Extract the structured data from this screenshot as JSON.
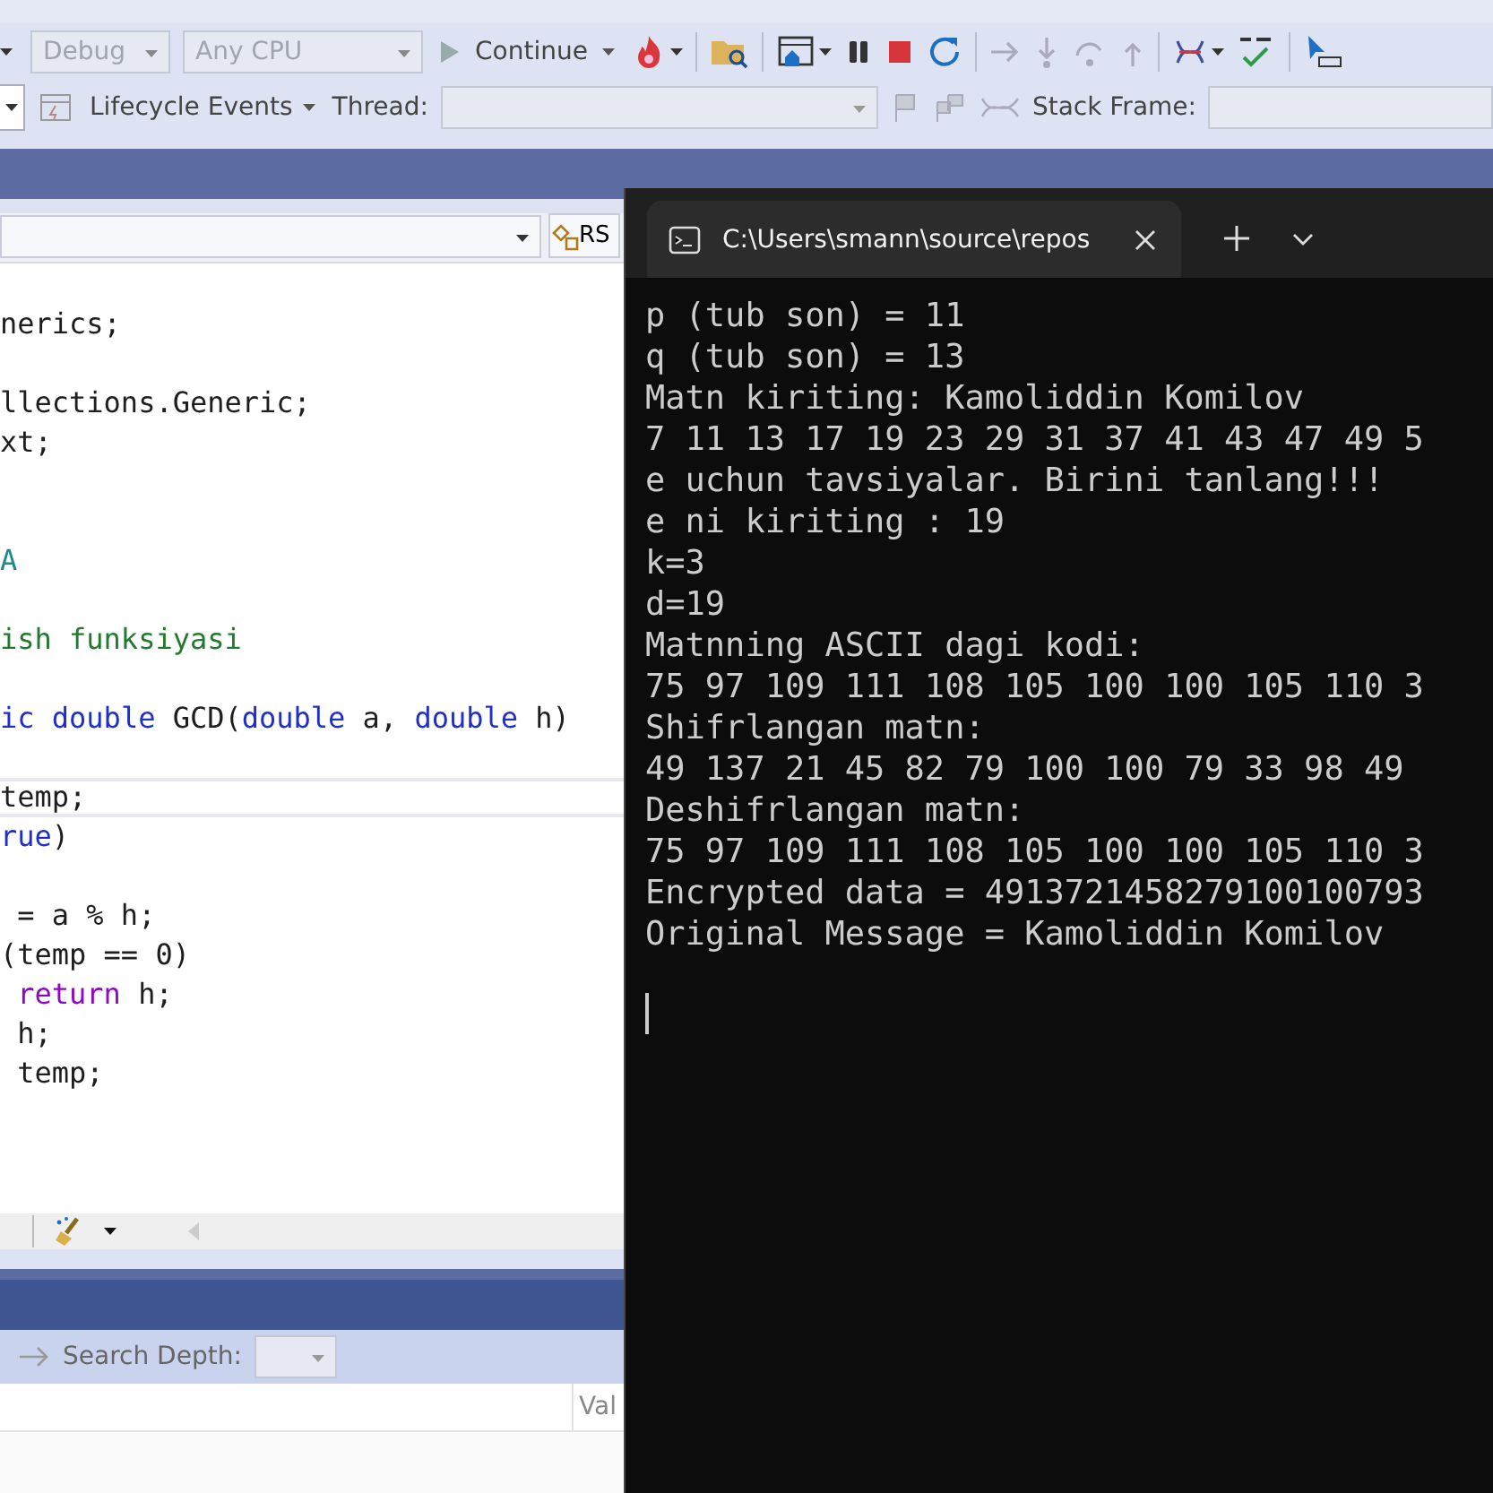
{
  "toolbar_row_1": {
    "configuration": {
      "value": "Debug",
      "disabled": true
    },
    "platform": {
      "value": "Any CPU",
      "disabled": true
    },
    "continue_button": "Continue"
  },
  "toolbar_row_2": {
    "lifecycle_events": "Lifecycle Events",
    "thread_label": "Thread:",
    "stack_frame_label": "Stack Frame:"
  },
  "editor": {
    "navigation_badge": "RS",
    "lines": [
      {
        "current": false,
        "tokens": [
          {
            "text": "nerics;",
            "kind": "plain"
          }
        ]
      },
      {
        "current": false
      },
      {
        "current": false,
        "tokens": [
          {
            "text": "llections.Generic;",
            "kind": "plain"
          }
        ]
      },
      {
        "current": false,
        "tokens": [
          {
            "text": "xt;",
            "kind": "plain"
          }
        ]
      },
      {
        "current": false
      },
      {
        "current": false
      },
      {
        "current": false,
        "tokens": [
          {
            "text": "A",
            "kind": "type"
          }
        ]
      },
      {
        "current": false
      },
      {
        "current": false,
        "tokens": [
          {
            "text": "ish funksiyasi",
            "kind": "comment"
          }
        ]
      },
      {
        "current": false
      },
      {
        "current": false,
        "tokens": [
          {
            "text": "ic ",
            "kind": "keyword"
          },
          {
            "text": "double",
            "kind": "keyword"
          },
          {
            "text": " GCD(",
            "kind": "plain"
          },
          {
            "text": "double",
            "kind": "keyword"
          },
          {
            "text": " a, ",
            "kind": "plain"
          },
          {
            "text": "double",
            "kind": "keyword"
          },
          {
            "text": " h)",
            "kind": "plain"
          }
        ]
      },
      {
        "current": false
      },
      {
        "current": true,
        "tokens": [
          {
            "text": "temp;",
            "kind": "plain"
          }
        ]
      },
      {
        "current": false,
        "tokens": [
          {
            "text": "rue",
            "kind": "keyword"
          },
          {
            "text": ")",
            "kind": "plain"
          }
        ]
      },
      {
        "current": false
      },
      {
        "current": false,
        "tokens": [
          {
            "text": " = a % h;",
            "kind": "plain"
          }
        ]
      },
      {
        "current": false,
        "tokens": [
          {
            "text": "(temp == 0)",
            "kind": "plain"
          }
        ]
      },
      {
        "current": false,
        "tokens": [
          {
            "text": " return",
            "kind": "control"
          },
          {
            "text": " h;",
            "kind": "plain"
          }
        ]
      },
      {
        "current": false,
        "tokens": [
          {
            "text": " h;",
            "kind": "plain"
          }
        ]
      },
      {
        "current": false,
        "tokens": [
          {
            "text": " temp;",
            "kind": "plain"
          }
        ]
      }
    ]
  },
  "bottom_panel": {
    "search_depth_label": "Search Depth:",
    "column_header": "Val"
  },
  "terminal": {
    "tab_title": "C:\\Users\\smann\\source\\repos",
    "lines": [
      "p (tub son) = 11",
      "q (tub son) = 13",
      "Matn kiriting: Kamoliddin Komilov",
      "7 11 13 17 19 23 29 31 37 41 43 47 49 5",
      "e uchun tavsiyalar. Birini tanlang!!!",
      "e ni kiriting : 19",
      "k=3",
      "d=19",
      "Matnning ASCII dagi kodi:",
      "75 97 109 111 108 105 100 100 105 110 3",
      "Shifrlangan matn:",
      "49 137 21 45 82 79 100 100 79 33 98 49",
      "Deshifrlangan matn:",
      "75 97 109 111 108 105 100 100 105 110 3",
      "Encrypted data = 4913721458279100100793",
      "Original Message = Kamoliddin Komilov"
    ]
  }
}
